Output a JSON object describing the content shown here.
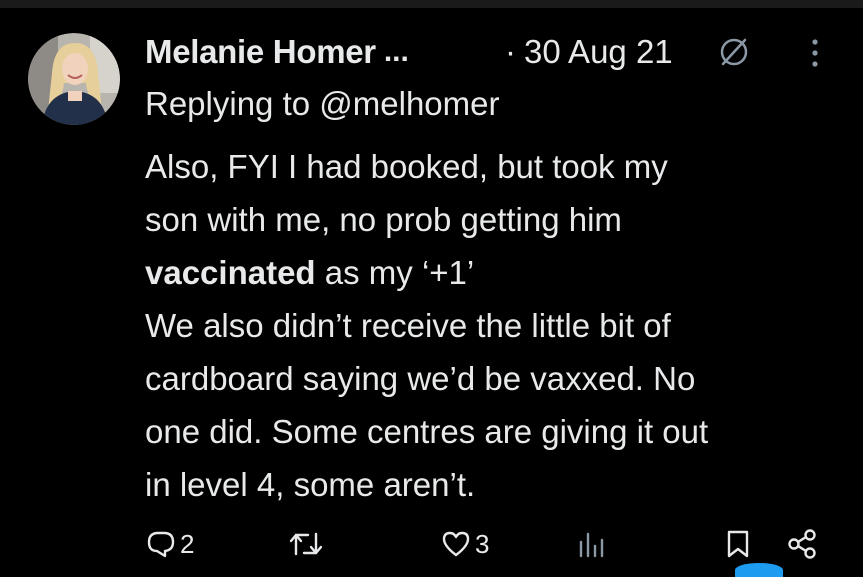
{
  "tweet": {
    "author_name": "Melanie Homer",
    "author_name_ellipsis": "...",
    "date_separator": "·",
    "date": "30 Aug 21",
    "replying_prefix": "Replying to",
    "replying_handle": "@melhomer",
    "lines": {
      "l1": "Also, FYI I had booked, but took my",
      "l2": "son with me,  no prob getting him",
      "l3_bold": "vaccinated",
      "l3_rest": " as my ‘+1’",
      "l4": "We also didn’t receive the little bit of",
      "l5": "cardboard saying we’d be vaxxed. No",
      "l6": "one did. Some centres are giving it out",
      "l7": "in level 4, some aren’t."
    }
  },
  "actions": {
    "reply_count": "2",
    "retweet_count": "",
    "like_count": "3",
    "views_count": ""
  },
  "icons": {
    "avatar": "avatar-photo",
    "slash": "slashed-circle-icon",
    "more": "more-vertical-icon",
    "reply": "reply-icon",
    "retweet": "retweet-icon",
    "like": "heart-icon",
    "views": "views-icon",
    "bookmark": "bookmark-icon",
    "share": "share-icon"
  },
  "colors": {
    "background": "#000000",
    "text": "#e7e9ea",
    "icon": "#e7e9ea",
    "accent": "#1d9bf0"
  }
}
